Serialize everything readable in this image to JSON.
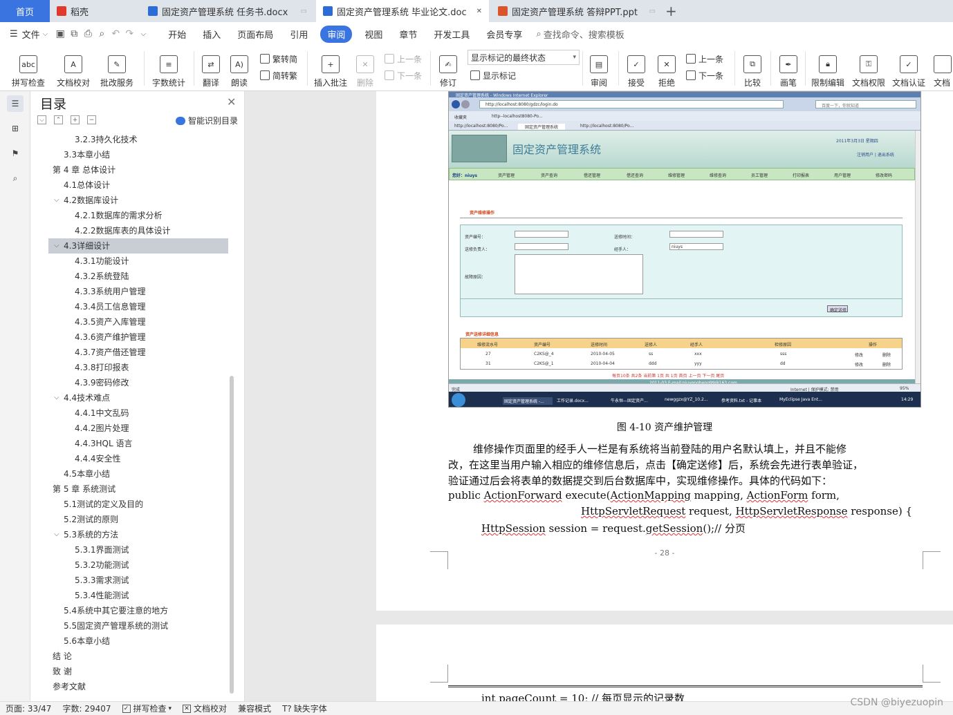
{
  "tabs": [
    {
      "label": "首页",
      "type": "home"
    },
    {
      "label": "稻壳",
      "icon": "docer-icon",
      "color": "#e0392b"
    },
    {
      "label": "固定资产管理系统 任务书.docx",
      "icon": "word-icon",
      "color": "#2b6cd8"
    },
    {
      "label": "固定资产管理系统 毕业论文.doc",
      "icon": "word-icon",
      "color": "#2b6cd8",
      "active": true
    },
    {
      "label": "固定资产管理系统 答辩PPT.ppt",
      "icon": "ppt-icon",
      "color": "#d9532b"
    }
  ],
  "tab_add": "+",
  "menu": {
    "file": "文件",
    "items": [
      "开始",
      "插入",
      "页面布局",
      "引用",
      "审阅",
      "视图",
      "章节",
      "开发工具",
      "会员专享"
    ],
    "active": "审阅",
    "search": "查找命令、搜索模板"
  },
  "ribbon": {
    "spell": "拼写检查",
    "proof": "文档校对",
    "batch": "批改服务",
    "wordcount": "字数统计",
    "translate": "翻译",
    "read": "朗读",
    "t2s": "繁转简",
    "s2t": "简转繁",
    "insert_comment": "插入批注",
    "delete": "删除",
    "prev_comment": "上一条",
    "next_comment": "下一条",
    "revise": "修订",
    "markup_select": "显示标记的最终状态",
    "show_markup": "显示标记",
    "review": "审阅",
    "accept": "接受",
    "reject": "拒绝",
    "prev_change": "上一条",
    "next_change": "下一条",
    "compare": "比较",
    "pen": "画笔",
    "restrict": "限制编辑",
    "permission": "文档权限",
    "certify": "文档认证",
    "more": "文档"
  },
  "toc": {
    "title": "目录",
    "smart": "智能识别目录",
    "items": [
      {
        "text": "3.2.3持久化技术",
        "level": 3
      },
      {
        "text": "3.3本章小结",
        "level": 2
      },
      {
        "text": "第 4 章  总体设计",
        "level": 1,
        "expanded": true
      },
      {
        "text": "4.1总体设计",
        "level": 2
      },
      {
        "text": "4.2数据库设计",
        "level": 2,
        "expanded": true
      },
      {
        "text": "4.2.1数据库的需求分析",
        "level": 3
      },
      {
        "text": "4.2.2数据库表的具体设计",
        "level": 3
      },
      {
        "text": "4.3详细设计",
        "level": 2,
        "expanded": true,
        "selected": true
      },
      {
        "text": "4.3.1功能设计",
        "level": 3
      },
      {
        "text": "4.3.2系统登陆",
        "level": 3
      },
      {
        "text": "4.3.3系统用户管理",
        "level": 3
      },
      {
        "text": "4.3.4员工信息管理",
        "level": 3
      },
      {
        "text": "4.3.5资产入库管理",
        "level": 3
      },
      {
        "text": "4.3.6资产维护管理",
        "level": 3
      },
      {
        "text": "4.3.7资产借还管理",
        "level": 3
      },
      {
        "text": "4.3.8打印报表",
        "level": 3
      },
      {
        "text": "4.3.9密码修改",
        "level": 3
      },
      {
        "text": "4.4技术难点",
        "level": 2,
        "expanded": true
      },
      {
        "text": "4.4.1中文乱码",
        "level": 3
      },
      {
        "text": "4.4.2图片处理",
        "level": 3
      },
      {
        "text": "4.4.3HQL 语言",
        "level": 3
      },
      {
        "text": "4.4.4安全性",
        "level": 3
      },
      {
        "text": "4.5本章小结",
        "level": 2
      },
      {
        "text": "第 5 章  系统测试",
        "level": 1,
        "expanded": true
      },
      {
        "text": "5.1测试的定义及目的",
        "level": 2
      },
      {
        "text": "5.2测试的原则",
        "level": 2
      },
      {
        "text": "5.3系统的方法",
        "level": 2,
        "expanded": true
      },
      {
        "text": "5.3.1界面测试",
        "level": 3
      },
      {
        "text": "5.3.2功能测试",
        "level": 3
      },
      {
        "text": "5.3.3需求测试",
        "level": 3
      },
      {
        "text": "5.3.4性能测试",
        "level": 3
      },
      {
        "text": "5.4系统中其它要注意的地方",
        "level": 2
      },
      {
        "text": "5.5固定资产管理系统的测试",
        "level": 2
      },
      {
        "text": "5.6本章小结",
        "level": 2
      },
      {
        "text": "结    论",
        "level": 1
      },
      {
        "text": "致    谢",
        "level": 1
      },
      {
        "text": "参考文献",
        "level": 1
      }
    ]
  },
  "screenshot": {
    "window_title": "固定资产管理系统 - Windows Internet Explorer",
    "url": "http://localhost:8080/gdzc/login.do",
    "search_placeholder": "百度一下，你就知道",
    "favorites": "收藏夹",
    "fav_link": "http--localhost8080-Po...",
    "tab1": "http://localhost:8080/Po...",
    "tab2": "固定资产管理系统",
    "tab3": "http://localhost:8080/Po...",
    "banner_title": "固定资产管理系统",
    "date": "2011年3月3日 星期四",
    "links": "注销用户 | 退出系统",
    "welcome": "您好：niuys",
    "nav": [
      "资产管理",
      "资产查询",
      "借还管理",
      "借还查询",
      "维修管理",
      "维修查询",
      "员工管理",
      "打印报表",
      "用户管理",
      "修改密码"
    ],
    "section_title": "资产维修操作",
    "f_asset": "资产编号：",
    "f_time": "送修时间：",
    "f_person": "送修负责人：",
    "f_handler": "经手人：",
    "f_handler_value": "niuys",
    "f_reason": "故障原因：",
    "submit": "确定送修",
    "list_title": "资产送修详细信息",
    "cols": [
      "维修流水号",
      "资产编号",
      "送修时间",
      "送修人",
      "经手人",
      "检修原因",
      "操作"
    ],
    "rows": [
      [
        "27",
        "C2KS@_4",
        "2010-04-05",
        "ss",
        "xxx",
        "sss"
      ],
      [
        "31",
        "C2KS@_1",
        "2010-04-04",
        "ddd",
        "yyy",
        "dd"
      ]
    ],
    "op_edit": "修改",
    "op_del": "删除",
    "pager": "每页10条  共2条  当前第 1页  共 1页  首页  上一页  下一页  尾页",
    "footer": "2011-03  E-mail:niuyongheng99@163.com",
    "status_left": "完成",
    "status_zone": "Internet | 保护模式: 禁用",
    "zoom": "95%",
    "taskbar": [
      "固定资产管理系统 -...",
      "工作记录.docx...",
      "牛永恒—固定资产...",
      "newggzx@YZ_10.2...",
      "参考资料.txt - 记事本",
      "MyEclipse Java Ent..."
    ],
    "clock": "14:29"
  },
  "document": {
    "figure_caption": "图 4-10    资产维护管理",
    "para1": "维修操作页面里的经手人一栏是有系统将当前登陆的用户名默认填上，并且不能修",
    "para2": "改，在这里当用户输入相应的维修信息后，点击【确定送修】后，系统会先进行表单验证，",
    "para3": "验证通过后会将表单的数据提交到后台数据库中，实现维修操作。具体的代码如下：",
    "code1a": "public ",
    "code1b": "ActionForward",
    "code1c": " execute(",
    "code1d": "ActionMapping",
    "code1e": " mapping, ",
    "code1f": "ActionForm",
    "code1g": " form,",
    "code2a": "HttpServletRequest",
    "code2b": " request, ",
    "code2c": "HttpServletResponse",
    "code2d": " response) {",
    "code3a": "HttpSession",
    "code3b": " session = request.",
    "code3c": "getSession",
    "code3d": "();//  分页",
    "page_number": "- 28 -",
    "next_page_code": "int pageCount = 10; // 每页显示的记录数"
  },
  "status": {
    "page": "页面: 33/47",
    "words": "字数: 29407",
    "spell": "拼写检查",
    "proof": "文档校对",
    "compat": "兼容模式",
    "missing_font": "缺失字体"
  },
  "watermark": "CSDN @biyezuopin"
}
